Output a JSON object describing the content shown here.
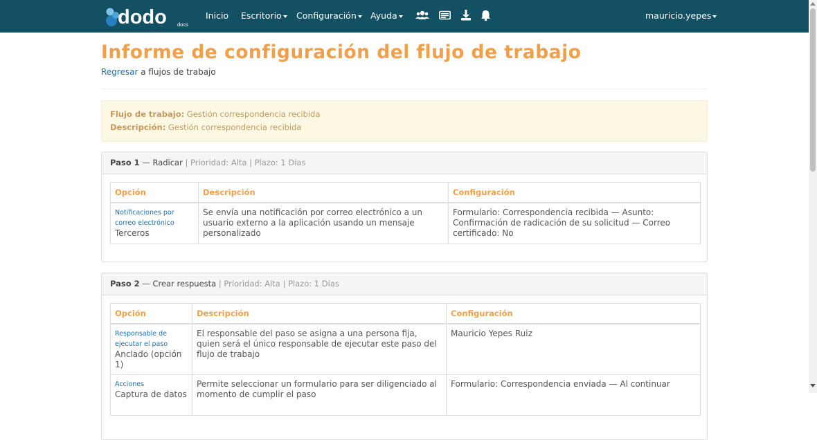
{
  "nav": {
    "logo_text": "dodo",
    "logo_sub": "docs",
    "items": [
      {
        "label": "Inicio"
      },
      {
        "label": "Escritorio"
      },
      {
        "label": "Configuración"
      },
      {
        "label": "Ayuda"
      }
    ],
    "icons": [
      "users-icon",
      "inbox-icon",
      "download-icon",
      "bell-icon"
    ],
    "user": "mauricio.yepes"
  },
  "colors": {
    "navbar": "#135063",
    "title": "#f0a04b",
    "link": "#1f6fa8",
    "alert_bg": "#fcf8e3",
    "alert_text": "#c49a5e"
  },
  "page": {
    "title": "Informe de configuración del flujo de trabajo",
    "back_link": "Regresar",
    "back_rest": " a flujos de trabajo"
  },
  "workflow": {
    "name_label": "Flujo de trabajo:",
    "name": "Gestión correspondencia recibida",
    "desc_label": "Descripción:",
    "desc": "Gestión correspondencia recibida"
  },
  "columns": [
    "Opción",
    "Descripción",
    "Configuración"
  ],
  "steps": [
    {
      "label": "Paso 1",
      "name": " — Radicar",
      "meta": " | Prioridad: Alta | Plazo: 1 Días",
      "rows": [
        {
          "option_title": "Notificaciones por correo electrónico",
          "option_value": "Terceros",
          "description": "Se envía una notificación por correo electrónico a un usuario externo a la aplicación usando un mensaje personalizado",
          "config": "Formulario: Correspondencia recibida — Asunto: Confirmación de radicación de su solicitud — Correo certificado: No"
        }
      ]
    },
    {
      "label": "Paso 2",
      "name": " — Crear respuesta",
      "meta": " | Prioridad: Alta | Plazo: 1 Días",
      "rows": [
        {
          "option_title": "Responsable de ejecutar el paso",
          "option_value": "Anclado (opción 1)",
          "description": "El responsable del paso se asigna a una persona fija, quien será el único responsable de ejecutar este paso del flujo de trabajo",
          "config": "Mauricio Yepes Ruiz"
        },
        {
          "option_title": "Acciones",
          "option_value": "Captura de datos",
          "description": "Permite seleccionar un formulario para ser diligenciado al momento de cumplir el paso",
          "config": "Formulario: Correspondencia enviada — Al continuar"
        }
      ]
    }
  ]
}
